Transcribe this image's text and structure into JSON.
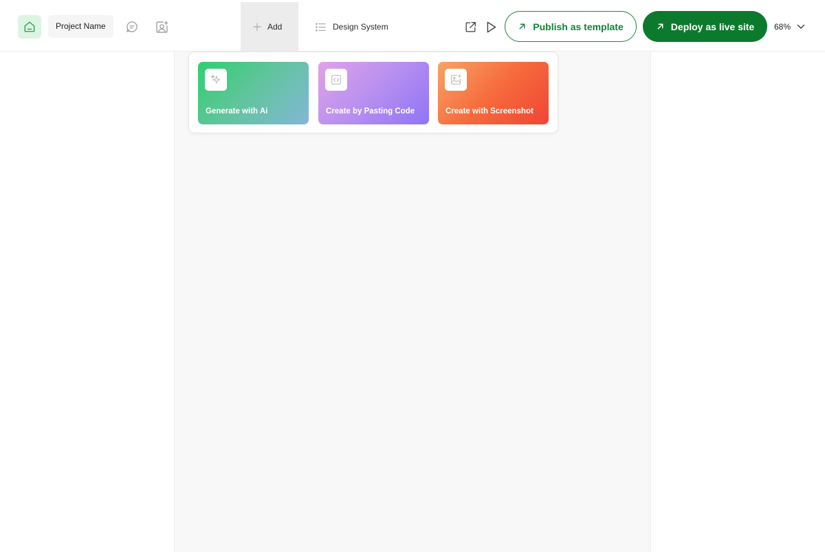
{
  "header": {
    "project_name": "Project Name",
    "add_label": "Add",
    "design_system_label": "Design System",
    "publish_label": "Publish as template",
    "deploy_label": "Deploy as live site",
    "zoom": "68%"
  },
  "add_menu": {
    "cards": [
      {
        "label": "Generate with Ai",
        "icon": "sparkle-icon"
      },
      {
        "label": "Create by Pasting Code",
        "icon": "code-icon"
      },
      {
        "label": "Create with Screenshot",
        "icon": "image-plus-icon"
      }
    ]
  },
  "colors": {
    "brand_green": "#0c7a2d",
    "home_bg": "#dcf5e3",
    "canvas_bg": "#f8f8f8"
  }
}
